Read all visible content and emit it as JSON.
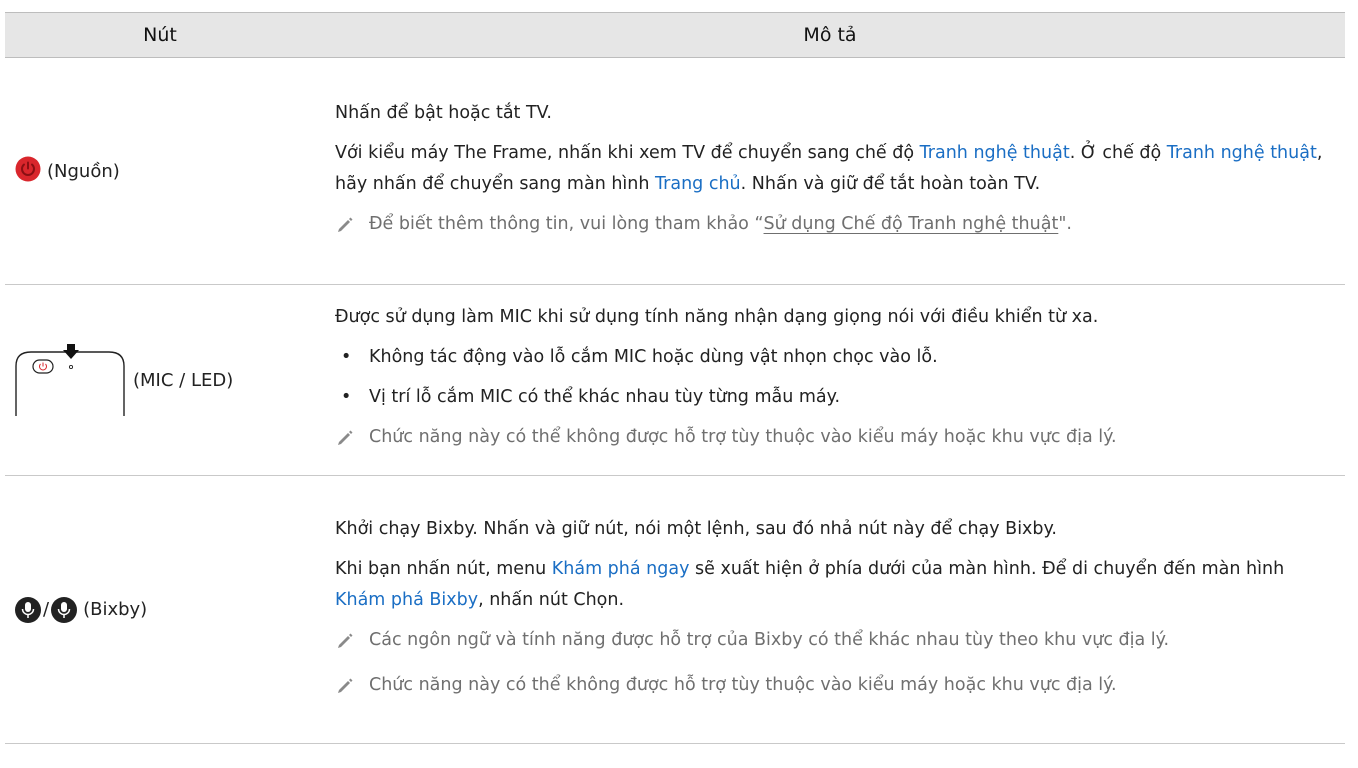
{
  "header": {
    "col_button": "Nút",
    "col_desc": "Mô tả"
  },
  "rows": [
    {
      "button_label": "(Nguồn)",
      "icon": "power-icon",
      "para1": "Nhấn để bật hoặc tắt TV.",
      "p2a": "Với kiểu máy The Frame, nhấn khi xem TV để chuyển sang chế độ ",
      "p2link1": "Tranh nghệ thuật",
      "p2b": ". Ở chế độ ",
      "p2link2": "Tranh nghệ thuật",
      "p2c": ", hãy nhấn để chuyển sang màn hình ",
      "p2link3": "Trang chủ",
      "p2d": ". Nhấn và giữ để tắt hoàn toàn TV.",
      "note_a": "Để biết thêm thông tin, vui lòng tham khảo “",
      "note_link": "Sử dụng Chế độ Tranh nghệ thuật",
      "note_b": "\"."
    },
    {
      "button_label": "(MIC / LED)",
      "icon": "remote-mic-icon",
      "para1": "Được sử dụng làm MIC khi sử dụng tính năng nhận dạng giọng nói với điều khiển từ xa.",
      "bullet1": "Không tác động vào lỗ cắm MIC hoặc dùng vật nhọn chọc vào lỗ.",
      "bullet2": "Vị trí lỗ cắm MIC có thể khác nhau tùy từng mẫu máy.",
      "note": "Chức năng này có thể không được hỗ trợ tùy thuộc vào kiểu máy hoặc khu vực địa lý."
    },
    {
      "button_label": "(Bixby)",
      "sep": "/",
      "icon": "bixby-mic-icon",
      "para1": "Khởi chạy Bixby. Nhấn và giữ nút, nói một lệnh, sau đó nhả nút này để chạy Bixby.",
      "p2a": "Khi bạn nhấn nút, menu ",
      "p2link1": "Khám phá ngay",
      "p2b": " sẽ xuất hiện ở phía dưới của màn hình. Để di chuyển đến màn hình ",
      "p2link2": "Khám phá Bixby",
      "p2c": ", nhấn nút Chọn.",
      "note1": "Các ngôn ngữ và tính năng được hỗ trợ của Bixby có thể khác nhau tùy theo khu vực địa lý.",
      "note2": "Chức năng này có thể không được hỗ trợ tùy thuộc vào kiểu máy hoặc khu vực địa lý."
    }
  ],
  "colors": {
    "link": "#1a6ec4",
    "header_bg": "#e6e6e6",
    "power_red": "#d9262c",
    "note_gray": "#6f6f6f"
  }
}
